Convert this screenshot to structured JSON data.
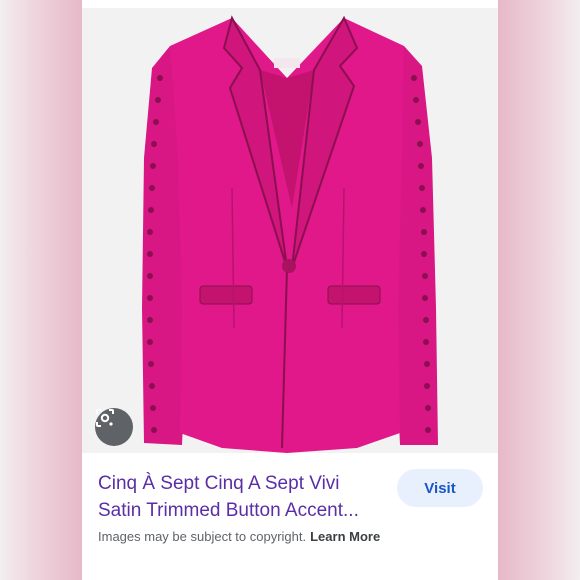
{
  "result": {
    "title": "Cinq À Sept Cinq A Sept Vivi Satin Trimmed Button Accent...",
    "visit_label": "Visit",
    "copyright_text": "Images may be subject to copyright.",
    "learn_more_label": "Learn More"
  },
  "image": {
    "subject": "pink-blazer",
    "colors": {
      "blazer": "#e0188a",
      "blazer_shadow": "#b8126f",
      "buttons": "#8a1050",
      "background": "#f2f2f2"
    }
  },
  "icons": {
    "lens": "google-lens-icon"
  }
}
